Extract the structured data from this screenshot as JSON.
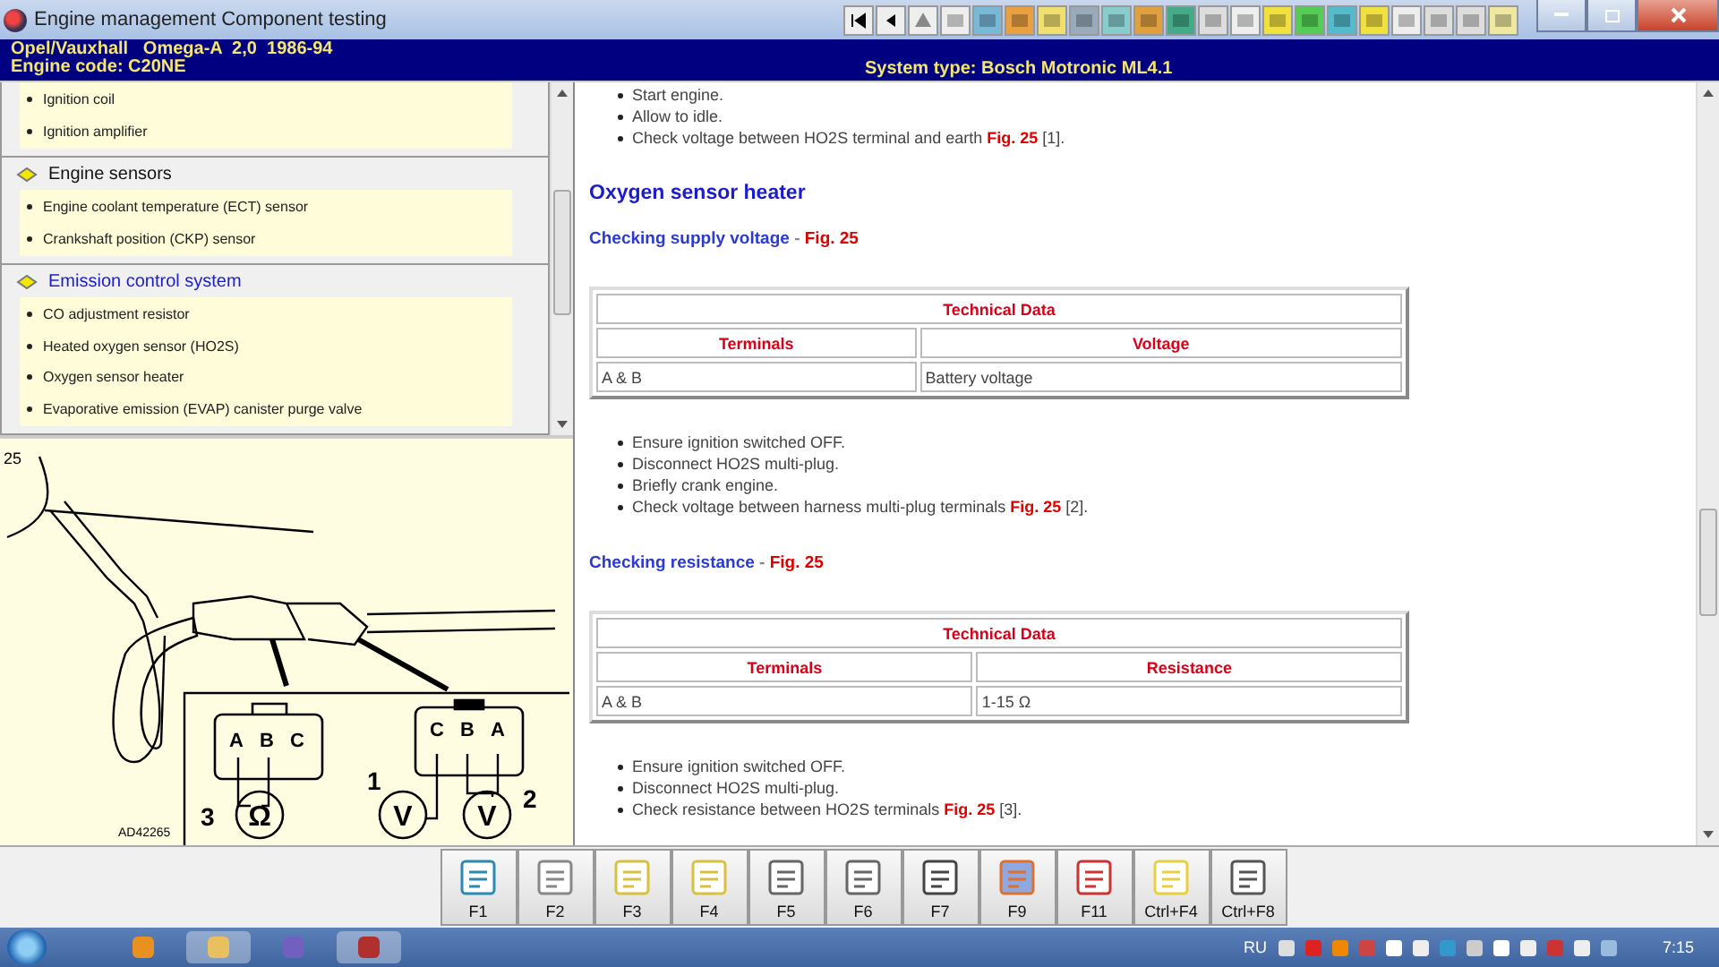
{
  "window": {
    "title": "Engine management Component testing"
  },
  "header": {
    "vehicle": "Opel/Vauxhall   Omega-A  2,0  1986-94",
    "engine_code": "Engine code: C20NE",
    "system_type": "System type: Bosch Motronic ML4.1"
  },
  "sidebar": {
    "sections": [
      {
        "items": [
          "Ignition coil",
          "Ignition amplifier"
        ]
      },
      {
        "title": "Engine sensors",
        "selected": false,
        "items": [
          "Engine coolant temperature (ECT) sensor",
          "Crankshaft position (CKP) sensor"
        ]
      },
      {
        "title": "Emission control system",
        "selected": true,
        "items": [
          "CO adjustment resistor",
          "Heated oxygen sensor (HO2S)",
          "Oxygen sensor heater",
          "Evaporative emission (EVAP) canister purge valve"
        ]
      }
    ]
  },
  "figure": {
    "number": "25",
    "code": "AD42265",
    "left_pins": [
      "A",
      "B",
      "C"
    ],
    "right_pins": [
      "C",
      "B",
      "A"
    ],
    "meter_labels": [
      "3",
      "1",
      "2"
    ],
    "meter_symbols": [
      "Ω",
      "V",
      "V"
    ]
  },
  "content": [
    {
      "kind": "bullets",
      "items": [
        {
          "text": "Start engine."
        },
        {
          "text": "Allow to idle."
        },
        {
          "text": "Check voltage between HO2S terminal and earth ",
          "fig": "Fig. 25",
          "ref": " [1]."
        }
      ]
    },
    {
      "kind": "heading",
      "text": "Oxygen sensor heater"
    },
    {
      "kind": "subheading",
      "text": "Checking supply voltage",
      "separator": "-",
      "fig": "Fig. 25"
    },
    {
      "kind": "table",
      "title": "Technical Data",
      "columns": [
        "Terminals",
        "Voltage"
      ],
      "rows": [
        [
          "A & B",
          "Battery voltage"
        ]
      ]
    },
    {
      "kind": "bullets",
      "items": [
        {
          "text": "Ensure ignition switched OFF."
        },
        {
          "text": "Disconnect HO2S multi-plug."
        },
        {
          "text": "Briefly crank engine."
        },
        {
          "text": "Check voltage between harness multi-plug terminals ",
          "fig": "Fig. 25",
          "ref": " [2]."
        }
      ]
    },
    {
      "kind": "subheading",
      "text": "Checking resistance",
      "separator": "-",
      "fig": "Fig. 25"
    },
    {
      "kind": "table",
      "title": "Technical Data",
      "columns": [
        "Terminals",
        "Resistance"
      ],
      "rows": [
        [
          "A & B",
          "1-15 Ω"
        ]
      ]
    },
    {
      "kind": "bullets",
      "items": [
        {
          "text": "Ensure ignition switched OFF."
        },
        {
          "text": "Disconnect HO2S multi-plug."
        },
        {
          "text": "Check resistance between HO2S terminals ",
          "fig": "Fig. 25",
          "ref": " [3]."
        }
      ]
    }
  ],
  "function_keys": [
    "F1",
    "F2",
    "F3",
    "F4",
    "F5",
    "F6",
    "F7",
    "F9",
    "F11",
    "Ctrl+F4",
    "Ctrl+F8"
  ],
  "taskbar": {
    "language": "RU",
    "clock": "7:15"
  }
}
